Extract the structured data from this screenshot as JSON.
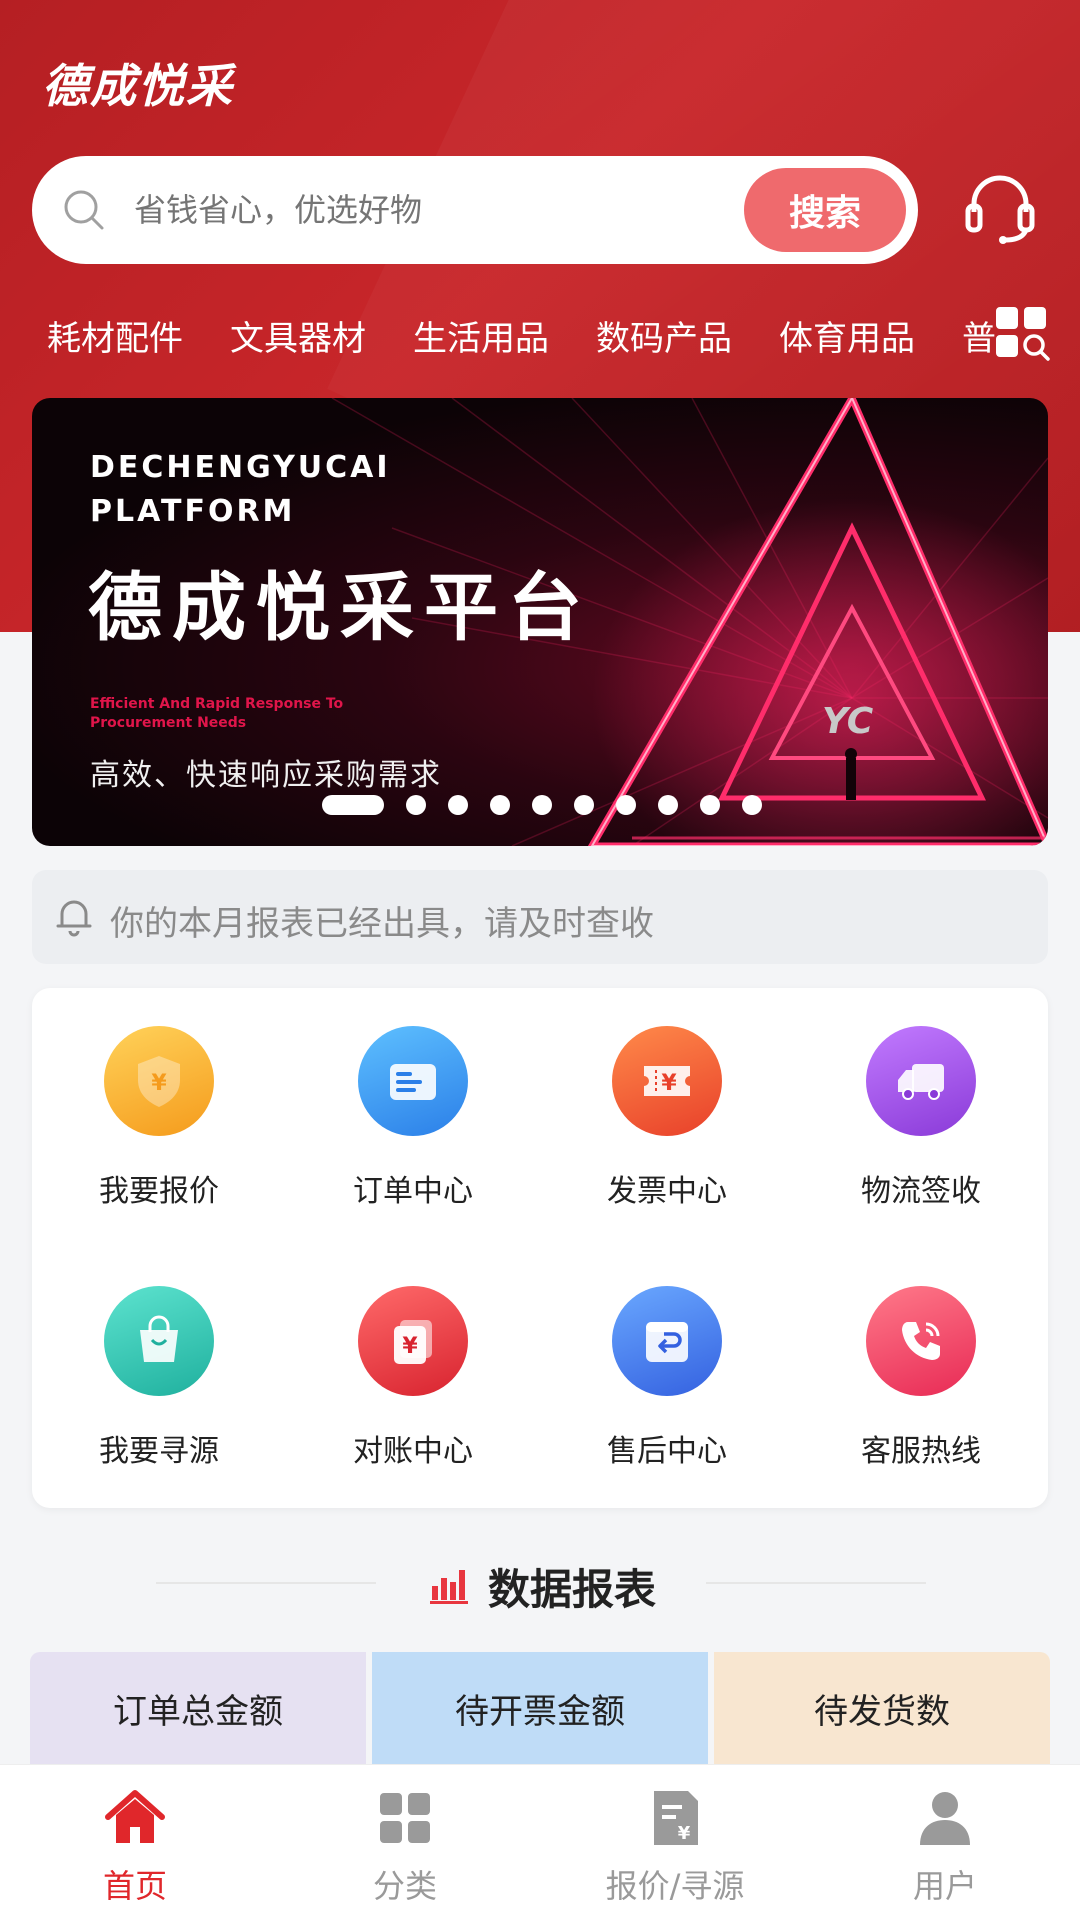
{
  "app": {
    "logo": "德成悦采"
  },
  "search": {
    "placeholder": "省钱省心，优选好物",
    "button": "搜索"
  },
  "categories": [
    "耗材配件",
    "文具器材",
    "生活用品",
    "数码产品",
    "体育用品",
    "普"
  ],
  "banner": {
    "en_line1": "DECHENGYUCAI",
    "en_line2": "PLATFORM",
    "title": "德成悦采平台",
    "small_line1": "Efficient And Rapid Response To",
    "small_line2": "Procurement Needs",
    "subtitle": "高效、快速响应采购需求",
    "slides_total": 10,
    "active_slide": 1
  },
  "notice": {
    "text": "你的本月报表已经出具，请及时查收"
  },
  "menu": [
    {
      "label": "我要报价",
      "icon": "shield-yen-icon",
      "color": "#f7a623"
    },
    {
      "label": "订单中心",
      "icon": "order-card-icon",
      "color": "#2f8ff0"
    },
    {
      "label": "发票中心",
      "icon": "invoice-ticket-icon",
      "color": "#f05a2a"
    },
    {
      "label": "物流签收",
      "icon": "truck-icon",
      "color": "#9b4de0"
    },
    {
      "label": "我要寻源",
      "icon": "shopping-bag-icon",
      "color": "#2cc3b0"
    },
    {
      "label": "对账中心",
      "icon": "reconcile-yen-icon",
      "color": "#e8363f"
    },
    {
      "label": "售后中心",
      "icon": "return-box-icon",
      "color": "#3a73e8"
    },
    {
      "label": "客服热线",
      "icon": "phone-icon",
      "color": "#ef3f6a"
    }
  ],
  "report": {
    "title": "数据报表"
  },
  "stats": [
    {
      "label": "订单总金额",
      "bg": "#e6e1f2"
    },
    {
      "label": "待开票金额",
      "bg": "#bfdcf7"
    },
    {
      "label": "待发货数",
      "bg": "#f8e6d0"
    }
  ],
  "tabs": [
    {
      "label": "首页",
      "icon": "home-icon",
      "active": true
    },
    {
      "label": "分类",
      "icon": "category-grid-icon",
      "active": false
    },
    {
      "label": "报价/寻源",
      "icon": "quote-doc-icon",
      "active": false
    },
    {
      "label": "用户",
      "icon": "user-icon",
      "active": false
    }
  ],
  "colors": {
    "brand_red": "#c8262a",
    "search_button": "#ef6a6d",
    "active_tab": "#e0272b"
  }
}
